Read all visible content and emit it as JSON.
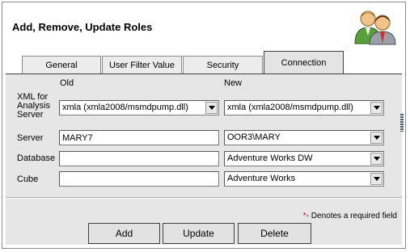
{
  "header": {
    "title": "Add, Remove, Update Roles",
    "icon": "users-icon"
  },
  "tabs": [
    {
      "label": "General",
      "active": false
    },
    {
      "label": "User Filter Value",
      "active": false
    },
    {
      "label": "Security",
      "active": false
    },
    {
      "label": "Connection",
      "active": true
    }
  ],
  "columns": {
    "old": "Old",
    "new": "New"
  },
  "rows": {
    "xmla": {
      "label_lines": [
        "XML for",
        "Analysis",
        "Server"
      ],
      "old_value": "xmla (xmla2008/msmdpump.dll)",
      "new_value": "xmla (xmla2008/msmdpump.dll)"
    },
    "server": {
      "label": "Server",
      "old_value": "MARY7",
      "new_value": "OOR3\\MARY"
    },
    "database": {
      "label": "Database",
      "old_value": "",
      "new_value": "Adventure Works DW"
    },
    "cube": {
      "label": "Cube",
      "old_value": "",
      "new_value": "Adventure Works"
    }
  },
  "footer": {
    "required_star": "*",
    "required_text": "- Denotes a required field"
  },
  "buttons": {
    "add": "Add",
    "update": "Update",
    "delete": "Delete"
  },
  "colors": {
    "panel_bg": "#e6e6e6",
    "tab_bg": "#ececec",
    "required_star": "#cc0000"
  }
}
